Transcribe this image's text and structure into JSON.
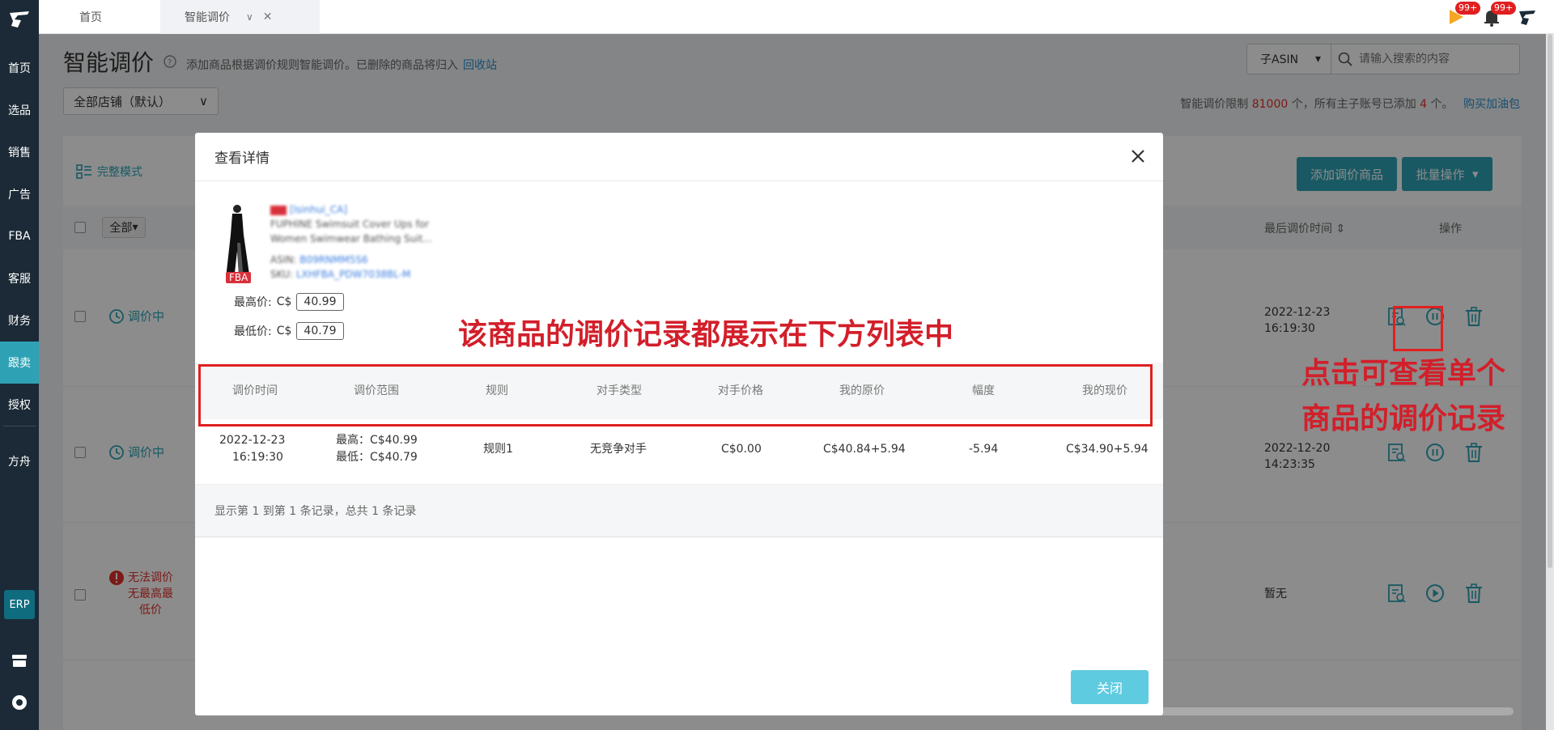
{
  "sidebar": {
    "items": [
      "首页",
      "选品",
      "销售",
      "广告",
      "FBA",
      "客服",
      "财务",
      "跟卖",
      "授权",
      "方舟"
    ],
    "active": "跟卖",
    "erp_label": "ERP"
  },
  "tabs": {
    "home": "首页",
    "current": "智能调价"
  },
  "notifications": {
    "flag_badge": "99+",
    "bell_badge": "99+"
  },
  "page": {
    "title": "智能调价",
    "subtitle": "添加商品根据调价规则智能调价。已删除的商品将归入",
    "recycle_link": "回收站",
    "search_type": "子ASIN",
    "search_placeholder": "请输入搜索的内容",
    "store_select": "全部店铺（默认）",
    "limit_prefix": "智能调价限制",
    "limit_value": "81000",
    "limit_mid": "个，所有主子账号已添加",
    "limit_added": "4",
    "limit_suffix": "个。",
    "limit_link": "购买加油包",
    "full_mode": "完整模式",
    "add_button": "添加调价商品",
    "batch_button": "批量操作",
    "all_filter": "全部",
    "col_last_time": "最后调价时间",
    "col_ops": "操作"
  },
  "rows": [
    {
      "status": "调价中",
      "time": [
        "2022-12-23",
        "16:19:30"
      ]
    },
    {
      "status": "调价中",
      "time": [
        "2022-12-20",
        "14:23:35"
      ]
    },
    {
      "status_lines": [
        "无法调价",
        "无最高最",
        "低价"
      ],
      "time": [
        "暂无"
      ]
    }
  ],
  "modal": {
    "title": "查看详情",
    "product": {
      "store": "[lsinhui_CA]",
      "title_line1": "FUPHINE Swimsuit Cover Ups for",
      "title_line2": "Women Swimwear Bathing Suit...",
      "asin_label": "ASIN:",
      "asin": "B09RNMM5S6",
      "sku_label": "SKU:",
      "sku": "LXHFBA_PDW7038BL-M",
      "fba": "FBA"
    },
    "max_label": "最高价:",
    "max_currency": "C$",
    "max_value": "40.99",
    "min_label": "最低价:",
    "min_currency": "C$",
    "min_value": "40.79",
    "columns": [
      "调价时间",
      "调价范围",
      "规则",
      "对手类型",
      "对手价格",
      "我的原价",
      "幅度",
      "我的现价"
    ],
    "record": {
      "date": "2022-12-23",
      "time": "16:19:30",
      "range_high": "最高：C$40.99",
      "range_low": "最低：C$40.79",
      "rule": "规则1",
      "rival_type": "无竞争对手",
      "rival_price": "C$0.00",
      "orig_price": "C$40.84+5.94",
      "change": "-5.94",
      "now_price": "C$34.90+5.94"
    },
    "pager": "显示第 1 到第 1 条记录，总共 1 条记录",
    "close_button": "关闭"
  },
  "annotations": {
    "center": "该商品的调价记录都展示在下方列表中",
    "right_line1": "点击可查看单个",
    "right_line2": "商品的调价记录"
  },
  "colors": {
    "sidebar": "#1b2a36",
    "accent": "#2ea2b4",
    "annotation_red": "#d21f2a"
  }
}
